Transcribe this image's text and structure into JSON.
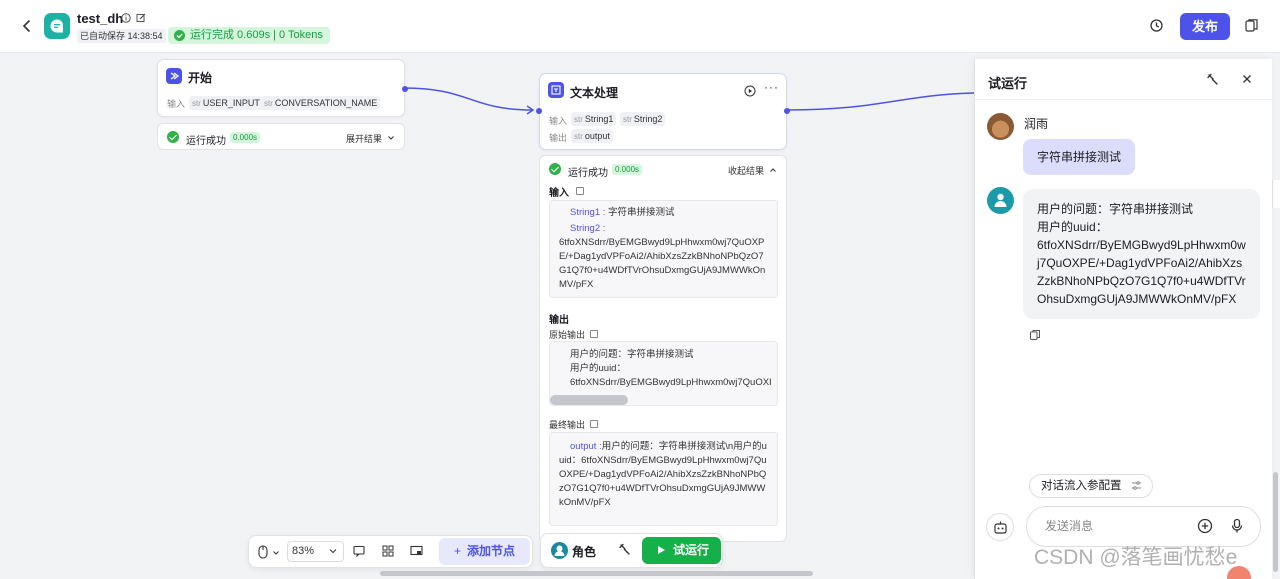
{
  "header": {
    "app_name": "test_dh",
    "autosave": "已自动保存 14:38:54",
    "run_status": "运行完成 0.609s | 0 Tokens",
    "publish": "发布"
  },
  "nodes": {
    "start": {
      "title": "开始",
      "input_label": "输入",
      "inputs": [
        {
          "type": "str",
          "name": "USER_INPUT"
        },
        {
          "type": "str",
          "name": "CONVERSATION_NAME"
        }
      ],
      "result": {
        "status": "运行成功",
        "time": "0.000s",
        "toggle": "展开结果"
      }
    },
    "text": {
      "title": "文本处理",
      "input_label": "输入",
      "output_label": "输出",
      "inputs": [
        {
          "type": "str",
          "name": "String1"
        },
        {
          "type": "str",
          "name": "String2"
        }
      ],
      "outputs": [
        {
          "type": "str",
          "name": "output"
        }
      ],
      "result": {
        "status": "运行成功",
        "time": "0.000s",
        "toggle": "收起结果",
        "input_section": "输入",
        "input_key1": "String1 :",
        "input_val1": "字符串拼接测试",
        "input_key2": "String2 :",
        "input_val2": "6tfoXNSdrr/ByEMGBwyd9LpHhwxm0wj7QuOXPE/+Dag1ydVPFoAi2/AhibXzsZzkBNhoNPbQzO7G1Q7f0+u4WDfTVrOhsuDxmgGUjA9JMWWkOnMV/pFX",
        "output_section": "输出",
        "raw_output_label": "原始输出",
        "raw_line1": "用户的问题：字符串拼接测试",
        "raw_line2": "用户的uuid：",
        "raw_line3": "6tfoXNSdrr/ByEMGBwyd9LpHhwxm0wj7QuOXI",
        "final_output_label": "最终输出",
        "final_key": "output :",
        "final_val": "用户的问题：字符串拼接测试\\n用户的uuid：6tfoXNSdrr/ByEMGBwyd9LpHhwxm0wj7QuOXPE/+Dag1ydVPFoAi2/AhibXzsZzkBNhoNPbQzO7G1Q7f0+u4WDfTVrOhsuDxmgGUjA9JMWWkOnMV/pFX"
      }
    }
  },
  "toolbar": {
    "zoom": "83%",
    "add_node": "添加节点",
    "role": "角色",
    "trial_run": "试运行"
  },
  "panel": {
    "title": "试运行",
    "user_name": "润雨",
    "user_message": "字符串拼接测试",
    "bot_line1": "用户的问题：字符串拼接测试",
    "bot_line2": "用户的uuid：",
    "bot_line3": "6tfoXNSdrr/ByEMGBwyd9LpHhwxm0wj7QuOXPE/+Dag1ydVPFoAi2/AhibXzsZzkBNhoNPbQzO7G1Q7f0+u4WDfTVrOhsuDxmgGUjA9JMWWkOnMV/pFX",
    "config_button": "对话流入参配置",
    "input_placeholder": "发送消息"
  },
  "watermark": "CSDN @落笔画忧愁e",
  "colors": {
    "accent": "#4d53e8",
    "success": "#15b04a",
    "success_bg": "#d5f5dd",
    "user_bubble": "#dcdcfc",
    "logo": "#1cb3a4"
  }
}
